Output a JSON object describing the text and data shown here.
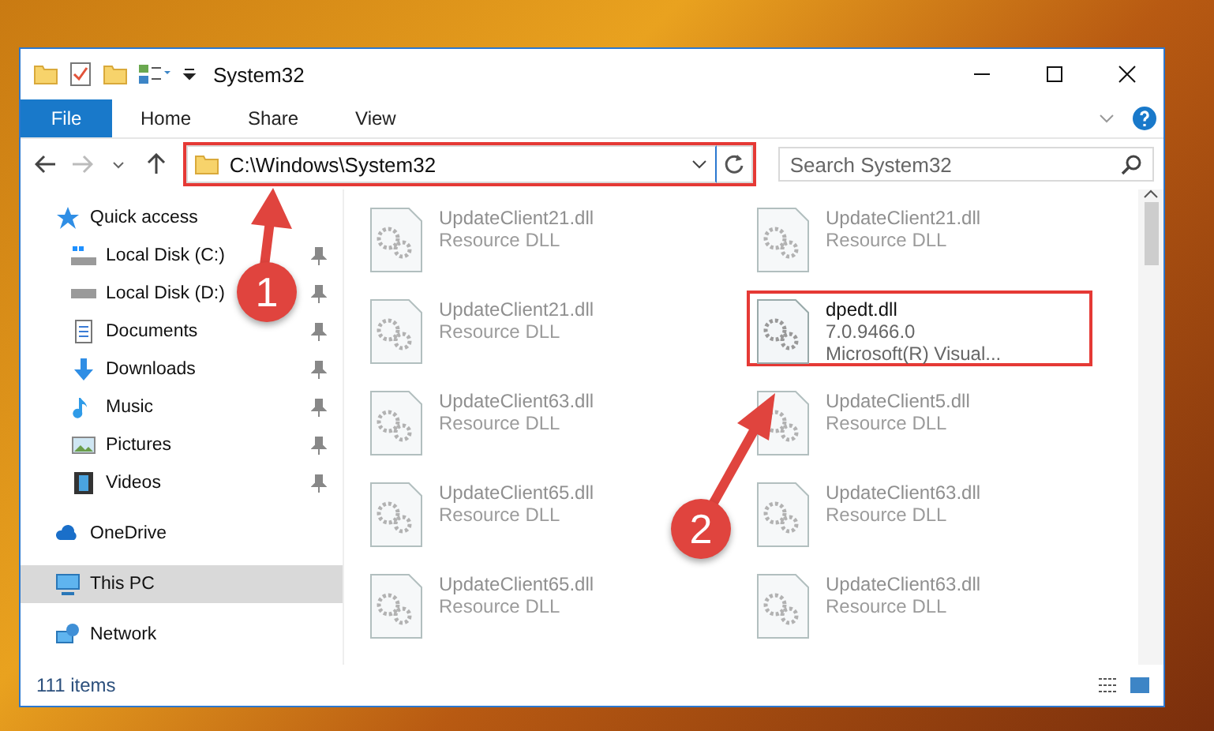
{
  "window": {
    "title": "System32"
  },
  "ribbon_tabs": [
    {
      "label": "File",
      "kind": "file"
    },
    {
      "label": "Home",
      "kind": "tab"
    },
    {
      "label": "Share",
      "kind": "tab"
    },
    {
      "label": "View",
      "kind": "tab"
    }
  ],
  "address": {
    "path": "C:\\Windows\\System32",
    "highlighted": true
  },
  "search": {
    "placeholder": "Search System32"
  },
  "sidebar": {
    "items": [
      {
        "label": "Quick access",
        "selected": false,
        "children": [
          {
            "label": "Local Disk (C:)",
            "pinned": true
          },
          {
            "label": "Local Disk (D:)",
            "pinned": true
          },
          {
            "label": "Documents",
            "pinned": true
          },
          {
            "label": "Downloads",
            "pinned": true
          },
          {
            "label": "Music",
            "pinned": true
          },
          {
            "label": "Pictures",
            "pinned": true
          },
          {
            "label": "Videos",
            "pinned": true
          }
        ]
      },
      {
        "label": "OneDrive",
        "selected": false
      },
      {
        "label": "This PC",
        "selected": true
      },
      {
        "label": "Network",
        "selected": false
      }
    ]
  },
  "files": [
    {
      "name": "UpdateClient21.dll",
      "detail": "Resource DLL",
      "faded": true,
      "highlighted": false
    },
    {
      "name": "UpdateClient21.dll",
      "detail": "Resource DLL",
      "faded": true,
      "highlighted": false
    },
    {
      "name": "UpdateClient21.dll",
      "detail": "Resource DLL",
      "faded": true,
      "highlighted": false
    },
    {
      "name": "dpedt.dll",
      "detail": "7.0.9466.0",
      "extra": "Microsoft(R) Visual...",
      "faded": false,
      "highlighted": true
    },
    {
      "name": "UpdateClient63.dll",
      "detail": "Resource DLL",
      "faded": true,
      "highlighted": false
    },
    {
      "name": "UpdateClient5.dll",
      "detail": "Resource DLL",
      "faded": true,
      "highlighted": false
    },
    {
      "name": "UpdateClient65.dll",
      "detail": "Resource DLL",
      "faded": true,
      "highlighted": false
    },
    {
      "name": "UpdateClient63.dll",
      "detail": "Resource DLL",
      "faded": true,
      "highlighted": false
    },
    {
      "name": "UpdateClient65.dll",
      "detail": "Resource DLL",
      "faded": true,
      "highlighted": false
    },
    {
      "name": "UpdateClient63.dll",
      "detail": "Resource DLL",
      "faded": true,
      "highlighted": false
    }
  ],
  "annotations": [
    {
      "number": "1"
    },
    {
      "number": "2"
    }
  ],
  "status_bar": {
    "count": "111 items"
  }
}
